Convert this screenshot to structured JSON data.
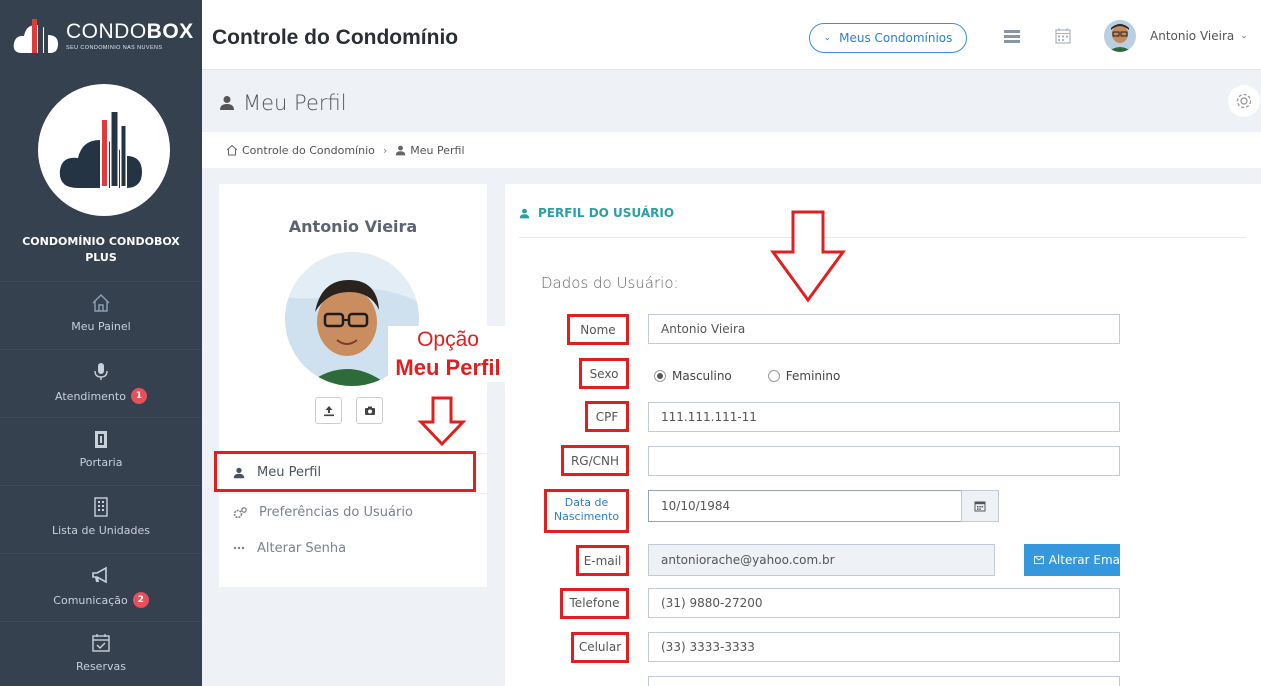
{
  "brand": {
    "name_light": "CONDO",
    "name_bold": "BOX",
    "tagline": "SEU CONDOMINIO NAS NUVENS"
  },
  "header": {
    "title": "Controle do Condomínio",
    "condos_button": "Meus Condomínios",
    "user_name": "Antonio Vieira",
    "icons": [
      "list-icon",
      "calendar-icon"
    ]
  },
  "sidebar": {
    "condo_name_line1": "CONDOMÍNIO CONDOBOX",
    "condo_name_line2": "PLUS",
    "items": [
      {
        "label": "Meu Painel",
        "icon": "home-icon"
      },
      {
        "label": "Atendimento",
        "icon": "microphone-icon",
        "badge": "1"
      },
      {
        "label": "Portaria",
        "icon": "door-icon"
      },
      {
        "label": "Lista de Unidades",
        "icon": "building-icon"
      },
      {
        "label": "Comunicação",
        "icon": "megaphone-icon",
        "badge": "2"
      },
      {
        "label": "Reservas",
        "icon": "calendar-check-icon"
      }
    ]
  },
  "page": {
    "title": "Meu Perfil",
    "breadcrumb": [
      "Controle do Condomínio",
      "Meu Perfil"
    ]
  },
  "profile_card": {
    "name": "Antonio Vieira",
    "menu": [
      {
        "label": "Meu Perfil",
        "icon": "user-icon",
        "active": true
      },
      {
        "label": "Preferências do Usuário",
        "icon": "cogs-icon"
      },
      {
        "label": "Alterar Senha",
        "icon": "ellipsis-icon"
      }
    ]
  },
  "user_panel": {
    "title": "PERFIL DO USUÁRIO",
    "section": "Dados do Usuário:",
    "fields": {
      "nome": {
        "label": "Nome",
        "value": "Antonio Vieira"
      },
      "sexo": {
        "label": "Sexo",
        "options": [
          "Masculino",
          "Feminino"
        ],
        "selected": "Masculino"
      },
      "cpf": {
        "label": "CPF",
        "value": "111.111.111-11"
      },
      "rg": {
        "label": "RG/CNH",
        "value": ""
      },
      "nascimento": {
        "label_line1": "Data de",
        "label_line2": "Nascimento",
        "value": "10/10/1984"
      },
      "email": {
        "label": "E-mail",
        "value": "antoniorache@yahoo.com.br",
        "button": "Alterar Ema"
      },
      "telefone": {
        "label": "Telefone",
        "value": "(31) 9880-27200"
      },
      "celular": {
        "label": "Celular",
        "value": "(33) 3333-3333"
      }
    }
  },
  "annotation": {
    "line1": "Opção",
    "line2": "Meu Perfil"
  },
  "colors": {
    "sidebar": "#364150",
    "accent": "#2aa0a6",
    "link": "#2a7fcf",
    "annotation": "#e02020",
    "button": "#3598dc"
  }
}
